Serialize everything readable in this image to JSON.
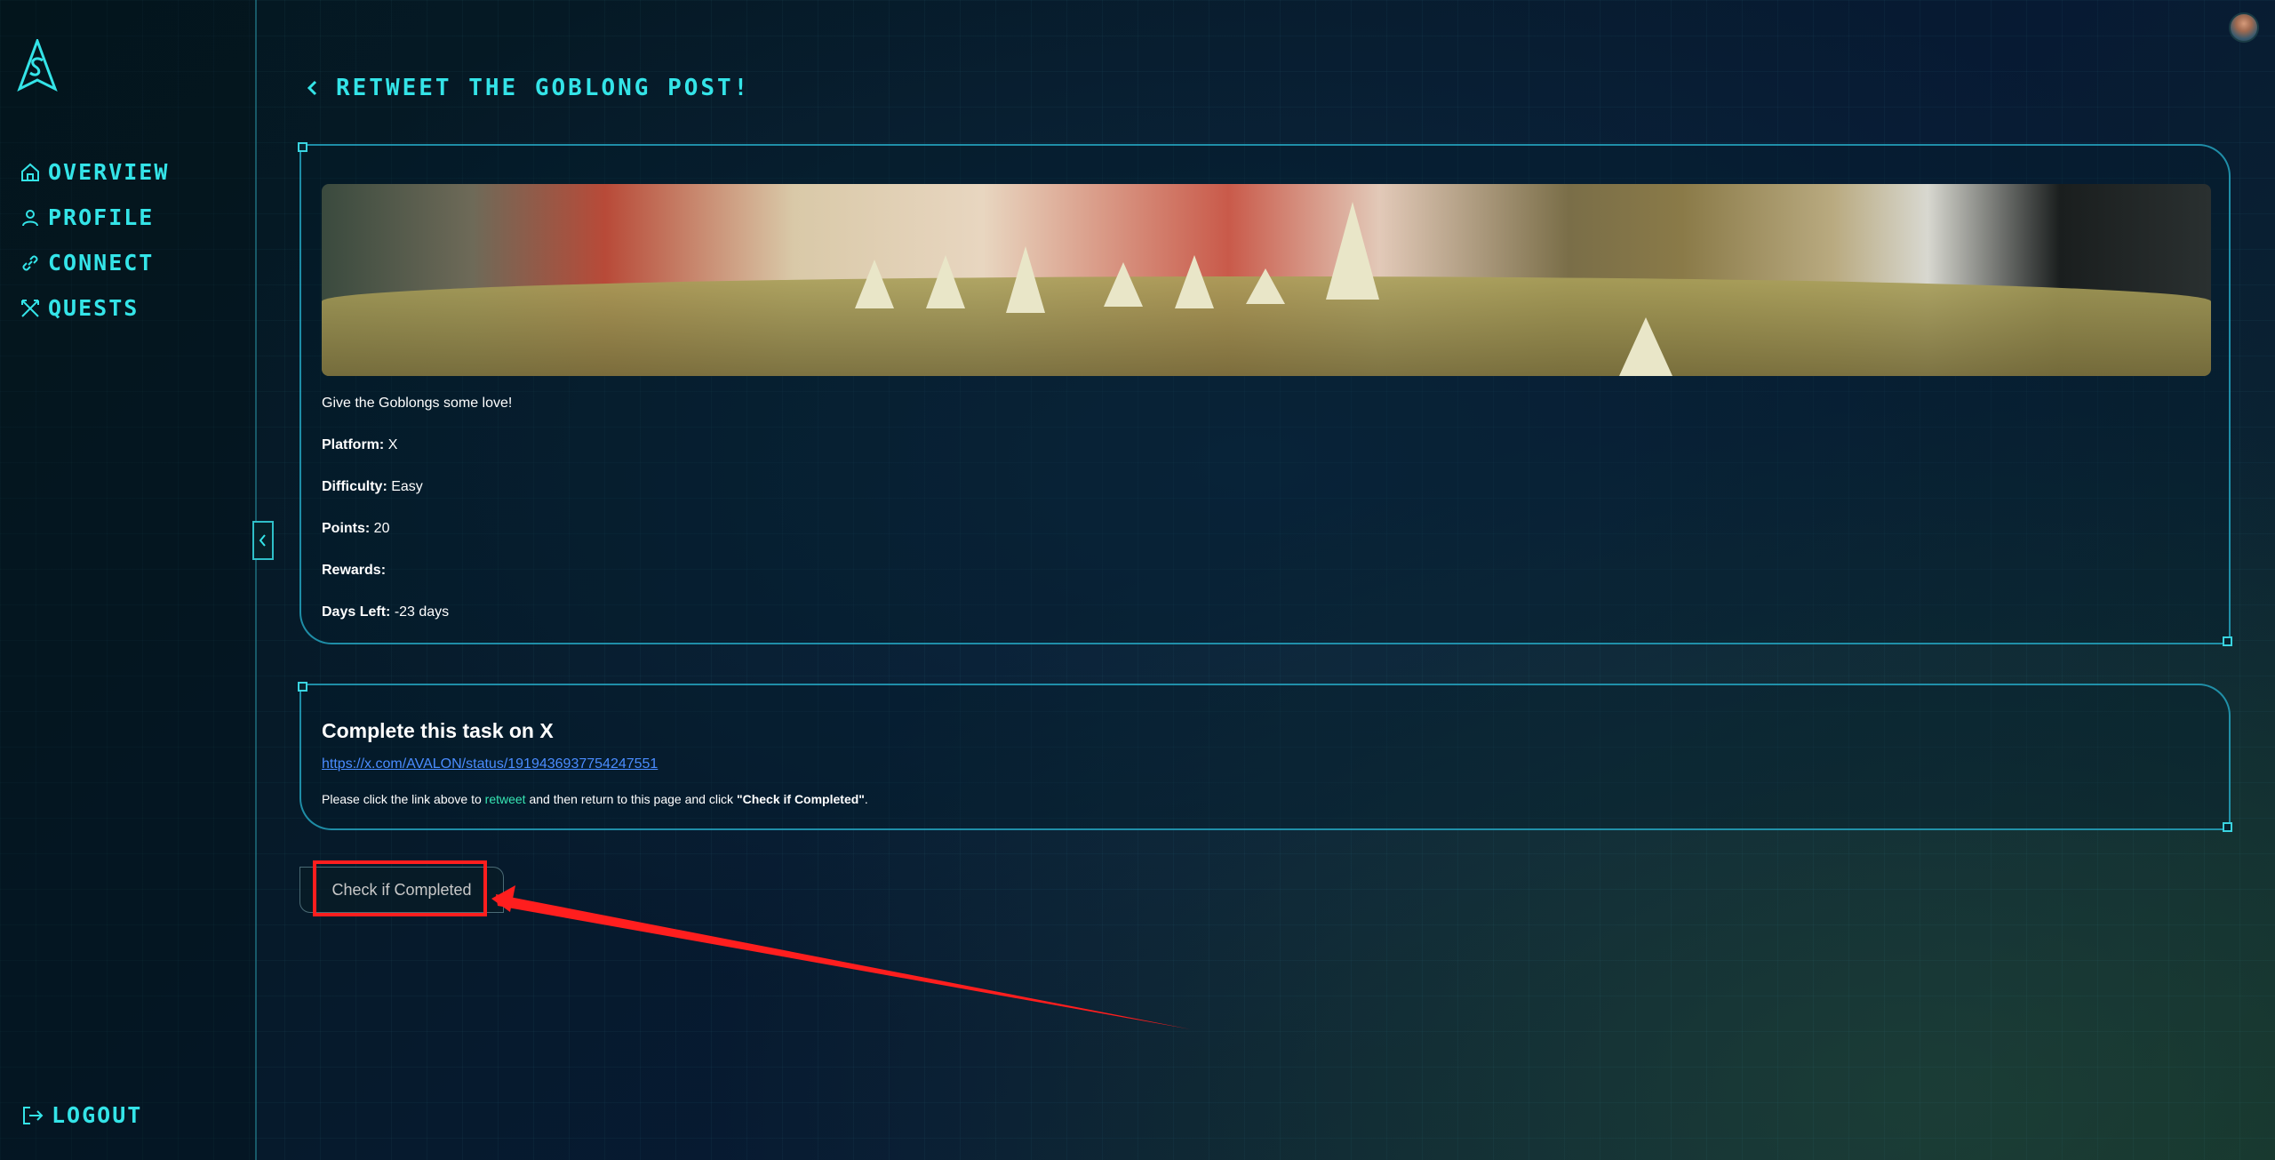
{
  "sidebar": {
    "items": [
      {
        "label": "OVERVIEW",
        "icon": "home-icon"
      },
      {
        "label": "PROFILE",
        "icon": "user-icon"
      },
      {
        "label": "CONNECT",
        "icon": "link-icon"
      },
      {
        "label": "QUESTS",
        "icon": "swords-icon"
      }
    ],
    "logout_label": "LOGOUT"
  },
  "header": {
    "title": "RETWEET THE GOBLONG POST!"
  },
  "quest": {
    "description": "Give the Goblongs some love!",
    "platform_label": "Platform:",
    "platform_value": "X",
    "difficulty_label": "Difficulty:",
    "difficulty_value": "Easy",
    "points_label": "Points:",
    "points_value": "20",
    "rewards_label": "Rewards:",
    "rewards_value": "",
    "days_left_label": "Days Left:",
    "days_left_value": "-23 days"
  },
  "task": {
    "title": "Complete this task on X",
    "link": "https://x.com/AVALON/status/1919436937754247551",
    "instruction_prefix": "Please click the link above to",
    "instruction_action": "retweet",
    "instruction_middle": "and then return to this page and click",
    "instruction_button_ref": "\"Check if Completed\"",
    "instruction_suffix": "."
  },
  "check_button_label": "Check if Completed",
  "colors": {
    "accent": "#34e4e8",
    "link": "#4a8cff",
    "action_highlight": "#37e6b4",
    "annotation": "#ff1e1e"
  }
}
